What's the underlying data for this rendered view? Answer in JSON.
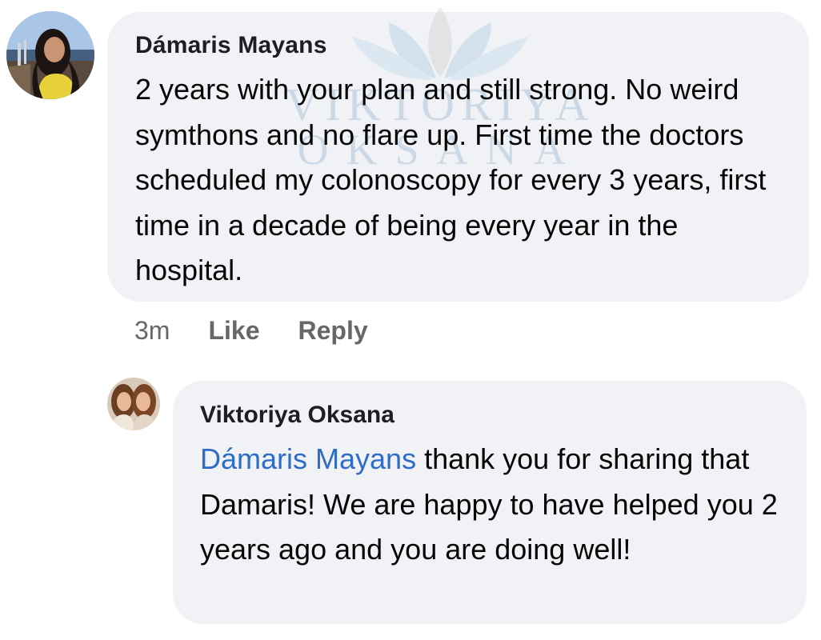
{
  "watermark": {
    "line1": "VIKTORIYA",
    "line2": "OKSANA"
  },
  "comment": {
    "author": "Dámaris Mayans",
    "text": "2 years with your plan and still strong. No weird symthons and no flare up. First time the doctors scheduled my colonoscopy for every 3 years, first time in a decade of being every year in the hospital.",
    "time": "3m",
    "like_label": "Like",
    "reply_label": "Reply"
  },
  "reply": {
    "author": "Viktoriya Oksana",
    "mention": "Dámaris Mayans",
    "text": " thank you for sharing that Damaris! We are happy to have helped you 2 years ago and you are doing well!"
  },
  "colors": {
    "bubble": "#f0f2f5",
    "mention": "#2d6dc8",
    "meta": "#65676b"
  }
}
